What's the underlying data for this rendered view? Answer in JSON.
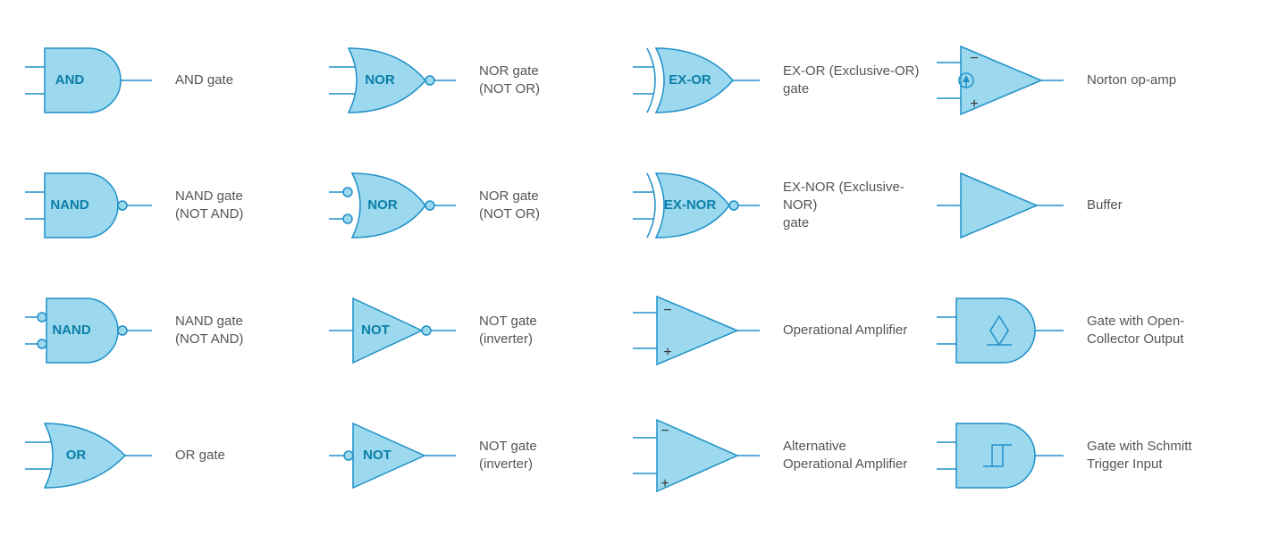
{
  "colors": {
    "fill": "#9CD8EE",
    "stroke": "#1E90C8",
    "label": "#0B7FA8",
    "text": "#555555"
  },
  "strokeWidth": 1.5,
  "cells": [
    {
      "r": 0,
      "c": 0,
      "gate": "and",
      "label": "AND",
      "desc": "AND gate"
    },
    {
      "r": 0,
      "c": 1,
      "gate": "nor",
      "label": "NOR",
      "desc": "NOR gate\n(NOT OR)"
    },
    {
      "r": 0,
      "c": 2,
      "gate": "xor",
      "label": "EX-OR",
      "desc": "EX-OR (Exclusive-OR)\ngate"
    },
    {
      "r": 0,
      "c": 3,
      "gate": "norton",
      "label": "",
      "desc": "Norton op-amp"
    },
    {
      "r": 1,
      "c": 0,
      "gate": "nand",
      "label": "NAND",
      "desc": "NAND gate\n(NOT AND)"
    },
    {
      "r": 1,
      "c": 1,
      "gate": "nor-ibub",
      "label": "NOR",
      "desc": "NOR gate\n(NOT OR)"
    },
    {
      "r": 1,
      "c": 2,
      "gate": "xnor",
      "label": "EX-NOR",
      "desc": "EX-NOR (Exclusive-NOR)\ngate"
    },
    {
      "r": 1,
      "c": 3,
      "gate": "buffer",
      "label": "",
      "desc": "Buffer"
    },
    {
      "r": 2,
      "c": 0,
      "gate": "nand-ibub",
      "label": "NAND",
      "desc": "NAND gate\n(NOT AND)"
    },
    {
      "r": 2,
      "c": 1,
      "gate": "not",
      "label": "NOT",
      "desc": "NOT gate\n(inverter)"
    },
    {
      "r": 2,
      "c": 2,
      "gate": "opamp",
      "label": "",
      "desc": "Operational Amplifier"
    },
    {
      "r": 2,
      "c": 3,
      "gate": "opencoll",
      "label": "",
      "desc": "Gate with Open-\nCollector Output"
    },
    {
      "r": 3,
      "c": 0,
      "gate": "or",
      "label": "OR",
      "desc": "OR gate"
    },
    {
      "r": 3,
      "c": 1,
      "gate": "not-ibub",
      "label": "NOT",
      "desc": "NOT gate\n(inverter)"
    },
    {
      "r": 3,
      "c": 2,
      "gate": "opamp-alt",
      "label": "",
      "desc": "Alternative\nOperational Amplifier"
    },
    {
      "r": 3,
      "c": 3,
      "gate": "schmitt",
      "label": "",
      "desc": "Gate with Schmitt\nTrigger Input"
    }
  ]
}
